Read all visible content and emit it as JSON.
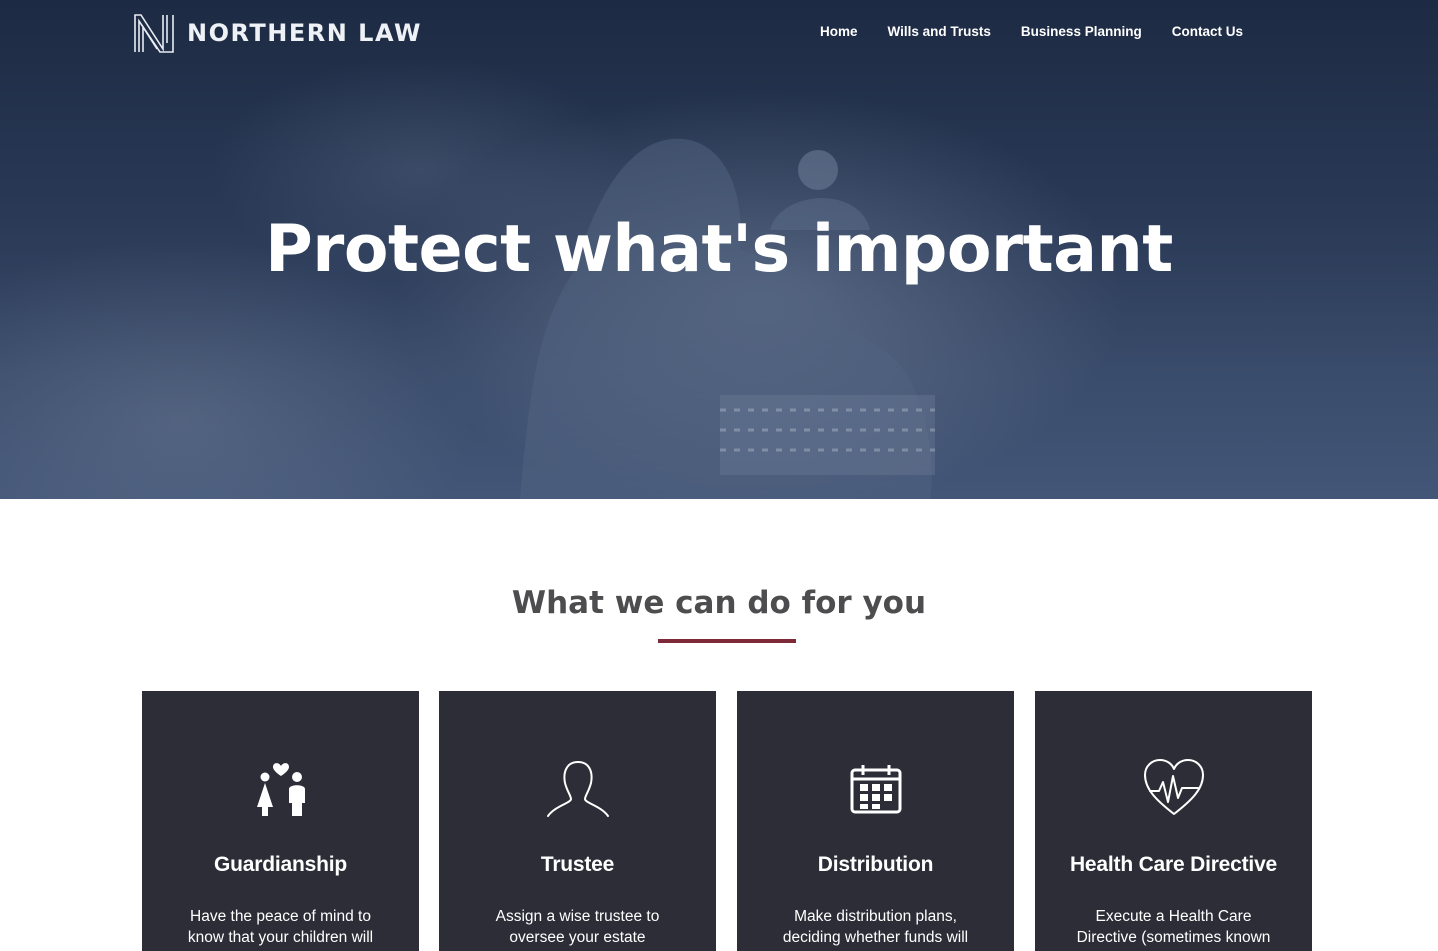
{
  "header": {
    "logo_text": "NORTHERN LAW",
    "nav": [
      "Home",
      "Wills and Trusts",
      "Business Planning",
      "Contact Us"
    ]
  },
  "hero": {
    "title": "Protect what's important"
  },
  "services": {
    "title": "What we can do for you",
    "accent_color": "#7f2a38",
    "card_color": "#2d2d38",
    "cards": [
      {
        "icon": "children-heart-icon",
        "title": "Guardianship",
        "desc": "Have the peace of mind to know that your children will"
      },
      {
        "icon": "person-icon",
        "title": "Trustee",
        "desc": "Assign a wise trustee to oversee your estate"
      },
      {
        "icon": "calendar-icon",
        "title": "Distribution",
        "desc": "Make distribution plans, deciding whether funds will"
      },
      {
        "icon": "heart-pulse-icon",
        "title": "Health Care Directive",
        "desc": "Execute a Health Care Directive (sometimes known"
      }
    ]
  }
}
